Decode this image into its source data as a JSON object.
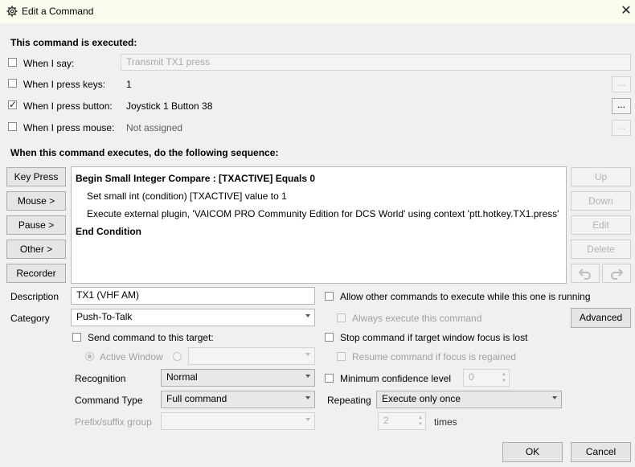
{
  "window": {
    "title": "Edit a Command"
  },
  "trigger": {
    "heading": "This command is executed:",
    "say": {
      "label": "When I say:",
      "value": "Transmit TX1 press",
      "checked": false
    },
    "keys": {
      "label": "When I press keys:",
      "value": "1",
      "checked": false,
      "dots": "..."
    },
    "button": {
      "label": "When I press button:",
      "value": "Joystick 1 Button 38",
      "checked": true,
      "dots": "..."
    },
    "mouse": {
      "label": "When I press mouse:",
      "value": "Not assigned",
      "checked": false,
      "dots": "..."
    }
  },
  "sequence": {
    "heading": "When this command executes, do the following sequence:",
    "add_buttons": [
      "Key Press",
      "Mouse >",
      "Pause >",
      "Other >",
      "Recorder"
    ],
    "lines": [
      "Begin Small Integer Compare : [TXACTIVE] Equals 0",
      "Set small int (condition) [TXACTIVE] value to 1",
      "Execute external plugin, 'VAICOM PRO Community Edition for DCS World' using context 'ptt.hotkey.TX1.press'",
      "End Condition"
    ],
    "side_buttons": [
      "Up",
      "Down",
      "Edit",
      "Delete"
    ]
  },
  "form": {
    "description_label": "Description",
    "description_value": "TX1 (VHF AM)",
    "category_label": "Category",
    "category_value": "Push-To-Talk",
    "send_target_label": "Send command to this target:",
    "active_window_label": "Active Window",
    "recognition_label": "Recognition",
    "recognition_value": "Normal",
    "command_type_label": "Command Type",
    "command_type_value": "Full command",
    "prefix_label": "Prefix/suffix group",
    "allow_other_label": "Allow other commands to execute while this one is running",
    "always_execute_label": "Always execute this command",
    "advanced_label": "Advanced",
    "stop_focus_label": "Stop command if target window focus is lost",
    "resume_focus_label": "Resume command if focus is regained",
    "min_conf_label": "Minimum confidence level",
    "min_conf_value": "0",
    "repeating_label": "Repeating",
    "repeating_value": "Execute only once",
    "times_value": "2",
    "times_label": "times"
  },
  "footer": {
    "ok_label": "OK",
    "cancel_label": "Cancel"
  }
}
